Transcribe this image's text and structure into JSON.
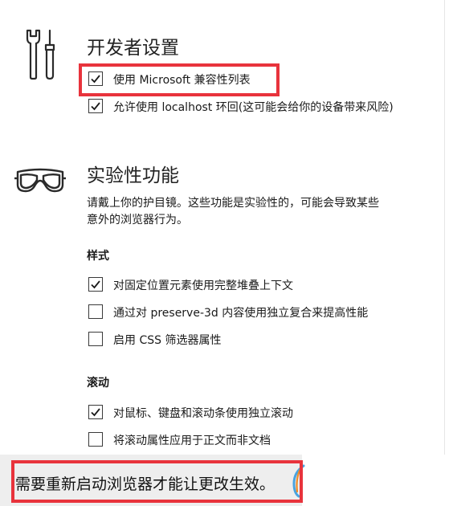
{
  "developer": {
    "title": "开发者设置",
    "icon": "tools-icon",
    "options": [
      {
        "label": "使用 Microsoft 兼容性列表",
        "checked": true
      },
      {
        "label": "允许使用 localhost 环回(这可能会给你的设备带来风险)",
        "checked": true
      }
    ]
  },
  "experimental": {
    "title": "实验性功能",
    "icon": "goggles-icon",
    "description_line1": "请戴上你的护目镜。这些功能是实验性的，可能会导致某些",
    "description_line2": "意外的浏览器行为。",
    "style_heading": "样式",
    "style_options": [
      {
        "label": "对固定位置元素使用完整堆叠上下文",
        "checked": true
      },
      {
        "label": "通过对 preserve-3d 内容使用独立复合来提高性能",
        "checked": false
      },
      {
        "label": "启用 CSS 筛选器属性",
        "checked": false
      }
    ],
    "scroll_heading": "滚动",
    "scroll_options": [
      {
        "label": "对鼠标、键盘和滚动条使用独立滚动",
        "checked": true
      },
      {
        "label": "将滚动属性应用于正文而非文档",
        "checked": false
      }
    ]
  },
  "notice": {
    "text": "需要重新启动浏览器才能让更改生效。"
  },
  "colors": {
    "highlight": "#e8333c",
    "notice_background": "#eeeeee"
  }
}
